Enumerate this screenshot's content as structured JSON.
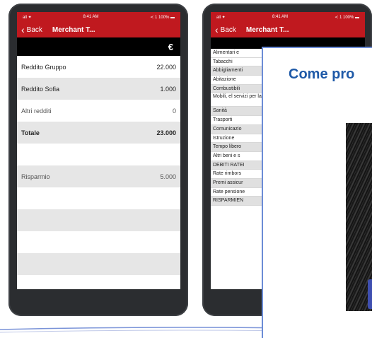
{
  "phone_left": {
    "status": {
      "left": "all ✦",
      "time": "8:41 AM",
      "right": "≺ 1 100% ▬"
    },
    "nav": {
      "back_label": "Back",
      "title": "Merchant T..."
    },
    "currency_symbol": "€",
    "rows": [
      {
        "label": "Reddito Gruppo",
        "value": "22.000"
      },
      {
        "label": "Reddito Sofia",
        "value": "1.000"
      },
      {
        "label": "Altri redditi",
        "value": "0"
      },
      {
        "label": "Totale",
        "value": "23.000"
      },
      {
        "label": "",
        "value": ""
      },
      {
        "label": "Risparmio",
        "value": "5.000"
      },
      {
        "label": "",
        "value": ""
      },
      {
        "label": "",
        "value": ""
      },
      {
        "label": "",
        "value": ""
      },
      {
        "label": "",
        "value": ""
      }
    ]
  },
  "phone_right": {
    "status": {
      "left": "all ✦",
      "time": "8:41 AM",
      "right": "≺ 1 100% ▬"
    },
    "nav": {
      "back_label": "Back",
      "title": "Merchant T..."
    },
    "items": [
      "Alimentari e",
      "Tabacchi",
      "Abbigliamenti",
      "Abitazione",
      "Combustibili",
      "Mobili, el servizi per la",
      "Sanità",
      "Trasporti",
      "Comunicazio",
      "Istruzione",
      "Tempo libero",
      "Altri beni e s",
      "DEBITI RATEI",
      "Rate rimbors",
      "Premi assicur",
      "Rate pensione",
      "RISPARMIEN"
    ]
  },
  "overlay": {
    "title": "Come pro"
  }
}
